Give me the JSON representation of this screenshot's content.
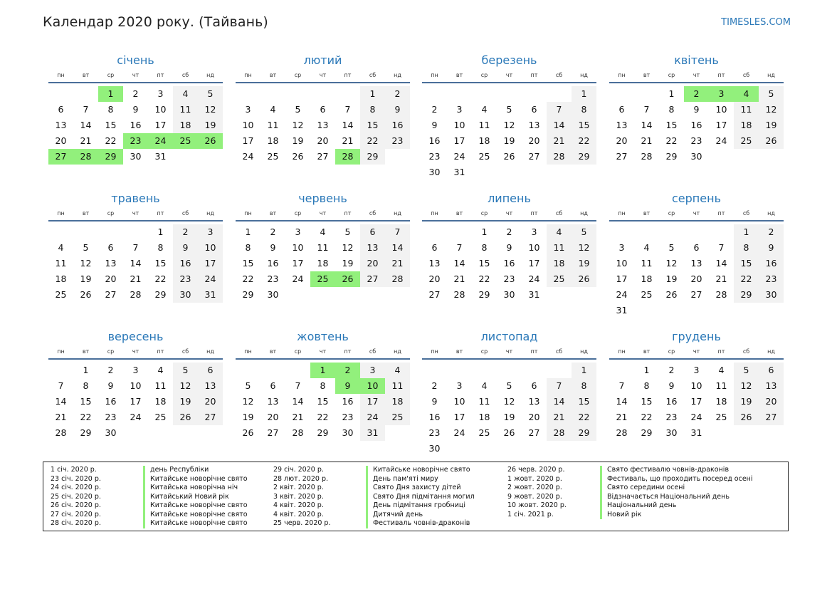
{
  "header": {
    "title": "Календар 2020 року. (Тайвань)",
    "site": "TIMESLES.COM"
  },
  "weekdays": [
    "пн",
    "вт",
    "ср",
    "чт",
    "пт",
    "сб",
    "нд"
  ],
  "colors": {
    "accent": "#2a78b8",
    "holiday": "#92f07c",
    "weekend": "#f2f2f2"
  },
  "months": [
    {
      "name": "січень",
      "start": 2,
      "days": 31,
      "holidays": [
        1,
        23,
        24,
        25,
        26,
        27,
        28,
        29
      ]
    },
    {
      "name": "лютий",
      "start": 5,
      "days": 29,
      "holidays": [
        28
      ]
    },
    {
      "name": "березень",
      "start": 6,
      "days": 31,
      "holidays": []
    },
    {
      "name": "квітень",
      "start": 2,
      "days": 30,
      "holidays": [
        2,
        3,
        4
      ]
    },
    {
      "name": "травень",
      "start": 4,
      "days": 31,
      "holidays": []
    },
    {
      "name": "червень",
      "start": 0,
      "days": 30,
      "holidays": [
        25,
        26
      ]
    },
    {
      "name": "липень",
      "start": 2,
      "days": 31,
      "holidays": []
    },
    {
      "name": "серпень",
      "start": 5,
      "days": 31,
      "holidays": []
    },
    {
      "name": "вересень",
      "start": 1,
      "days": 30,
      "holidays": []
    },
    {
      "name": "жовтень",
      "start": 3,
      "days": 31,
      "holidays": [
        1,
        2,
        9,
        10
      ]
    },
    {
      "name": "листопад",
      "start": 6,
      "days": 30,
      "holidays": []
    },
    {
      "name": "грудень",
      "start": 1,
      "days": 31,
      "holidays": []
    }
  ],
  "legend": [
    [
      {
        "date": "1 січ. 2020 р.",
        "name": "день Республіки"
      },
      {
        "date": "23 січ. 2020 р.",
        "name": "Китайське новорічне свято"
      },
      {
        "date": "24 січ. 2020 р.",
        "name": "Китайська новорічна ніч"
      },
      {
        "date": "25 січ. 2020 р.",
        "name": "Китайський Новий рік"
      },
      {
        "date": "26 січ. 2020 р.",
        "name": "Китайське новорічне свято"
      },
      {
        "date": "27 січ. 2020 р.",
        "name": "Китайське новорічне свято"
      },
      {
        "date": "28 січ. 2020 р.",
        "name": "Китайське новорічне свято"
      }
    ],
    [
      {
        "date": "29 січ. 2020 р.",
        "name": "Китайське новорічне свято"
      },
      {
        "date": "28 лют. 2020 р.",
        "name": "День пам'яті миру"
      },
      {
        "date": "2 квіт. 2020 р.",
        "name": "Свято Дня захисту дітей"
      },
      {
        "date": "3 квіт. 2020 р.",
        "name": "Свято Дня підмітання могил"
      },
      {
        "date": "4 квіт. 2020 р.",
        "name": "День підмітання гробниці"
      },
      {
        "date": "4 квіт. 2020 р.",
        "name": "Дитячий день"
      },
      {
        "date": "25 черв. 2020 р.",
        "name": "Фестиваль човнів-драконів"
      }
    ],
    [
      {
        "date": "26 черв. 2020 р.",
        "name": "Свято фестивалю човнів-драконів"
      },
      {
        "date": "1 жовт. 2020 р.",
        "name": "Фестиваль, що проходить посеред осені"
      },
      {
        "date": "2 жовт. 2020 р.",
        "name": "Свято середини осені"
      },
      {
        "date": "9 жовт. 2020 р.",
        "name": "Відзначається Національний день"
      },
      {
        "date": "10 жовт. 2020 р.",
        "name": "Національний день"
      },
      {
        "date": "1 січ. 2021 р.",
        "name": "Новий рік"
      }
    ]
  ]
}
